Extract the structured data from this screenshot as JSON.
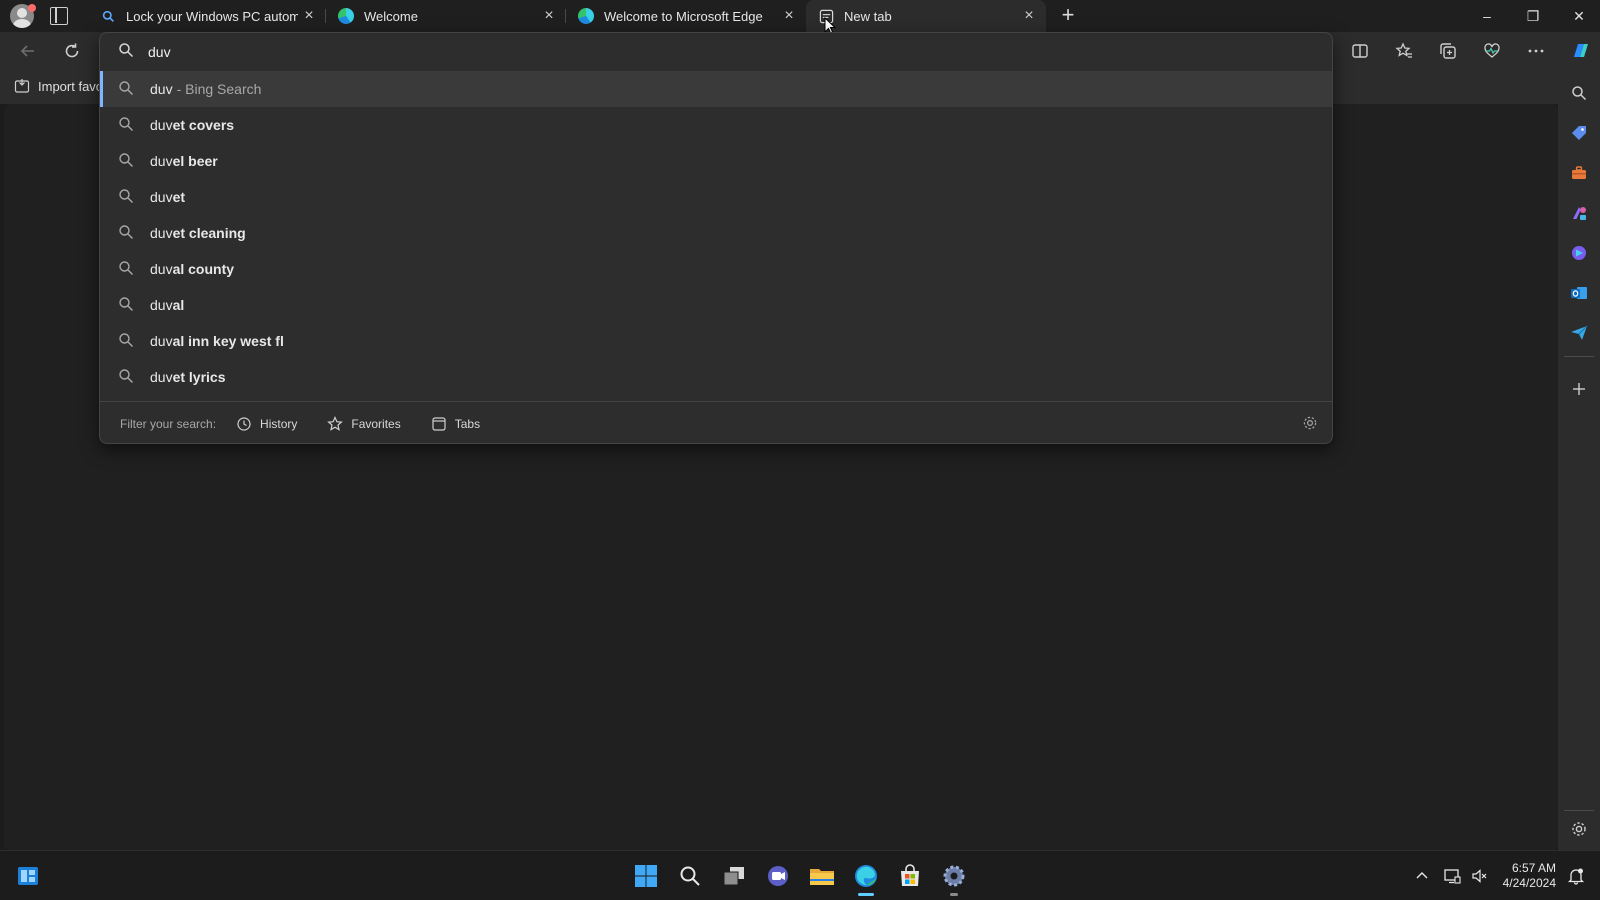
{
  "tabs": [
    {
      "title": "Lock your Windows PC automati",
      "favicon": "search-icon",
      "close": "×"
    },
    {
      "title": "Welcome",
      "favicon": "edge-logo-icon",
      "close": "×"
    },
    {
      "title": "Welcome to Microsoft Edge",
      "favicon": "edge-logo-icon",
      "close": "×"
    },
    {
      "title": "New tab",
      "favicon": "new-tab-page-icon",
      "close": "×",
      "active": true
    }
  ],
  "window_controls": {
    "minimize": "–",
    "restore": "❐",
    "close": "✕"
  },
  "new_tab_symbol": "+",
  "bookmarks": {
    "import_label": "Import favo"
  },
  "omnibox": {
    "query": "duv",
    "suggestions": [
      {
        "typed": "duv",
        "completion": "",
        "suffix": "- Bing Search",
        "selected": true
      },
      {
        "typed": "duv",
        "completion": "et covers",
        "suffix": ""
      },
      {
        "typed": "duv",
        "completion": "el beer",
        "suffix": ""
      },
      {
        "typed": "duv",
        "completion": "et",
        "suffix": ""
      },
      {
        "typed": "duv",
        "completion": "et cleaning",
        "suffix": ""
      },
      {
        "typed": "duv",
        "completion": "al county",
        "suffix": ""
      },
      {
        "typed": "duv",
        "completion": "al",
        "suffix": ""
      },
      {
        "typed": "duv",
        "completion": "al inn key west fl",
        "suffix": ""
      },
      {
        "typed": "duv",
        "completion": "et lyrics",
        "suffix": ""
      }
    ],
    "filter_label": "Filter your search:",
    "filters": [
      "History",
      "Favorites",
      "Tabs"
    ]
  },
  "taskbar": {
    "time": "6:57 AM",
    "date": "4/24/2024"
  },
  "colors": {
    "accent": "#60cdff",
    "selection_bar": "#7fb4ff",
    "background": "#1c1c1c"
  }
}
